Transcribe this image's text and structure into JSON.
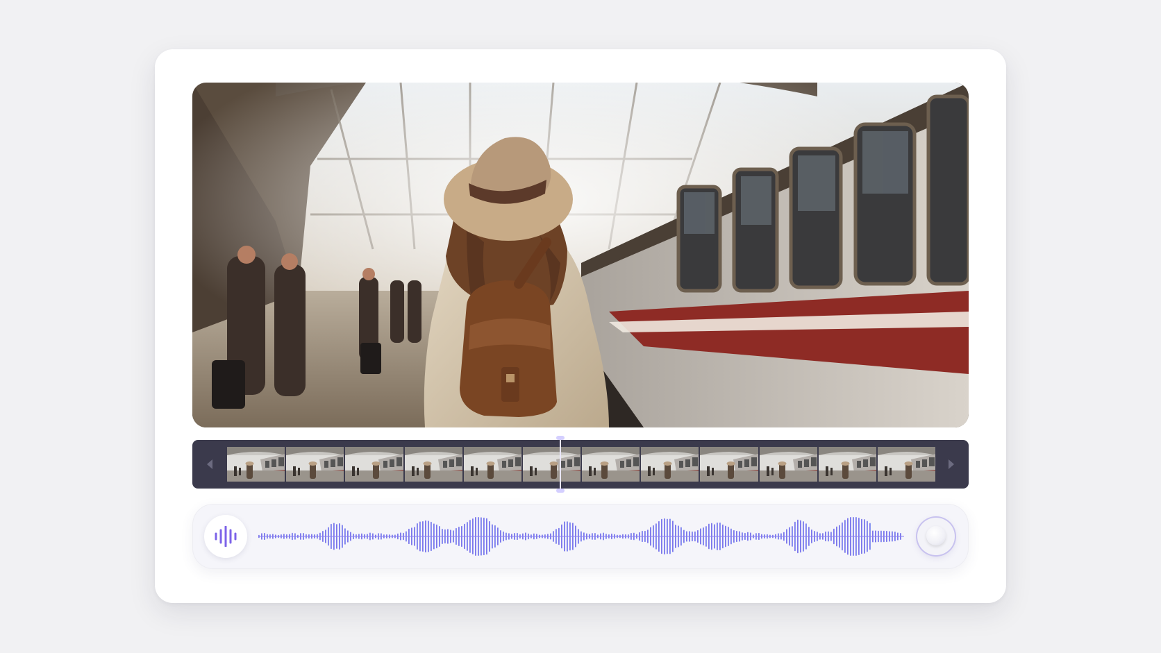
{
  "window": {
    "title": ""
  },
  "video": {
    "subject_icon": "traveler-photo",
    "scene": ""
  },
  "timeline": {
    "left_icon": "chevron-left-icon",
    "right_icon": "chevron-right-icon",
    "frame_count": 12,
    "playhead_position": 0.47,
    "colors": {
      "background": "#3b3a4c",
      "playhead": "#e9e6ff"
    }
  },
  "audio": {
    "icon": "audio-wave-icon",
    "volume_level": 0.5,
    "colors": {
      "wave_start": "#7c63e8",
      "wave_end": "#8da6f4",
      "accent": "#c8c2ef"
    }
  }
}
